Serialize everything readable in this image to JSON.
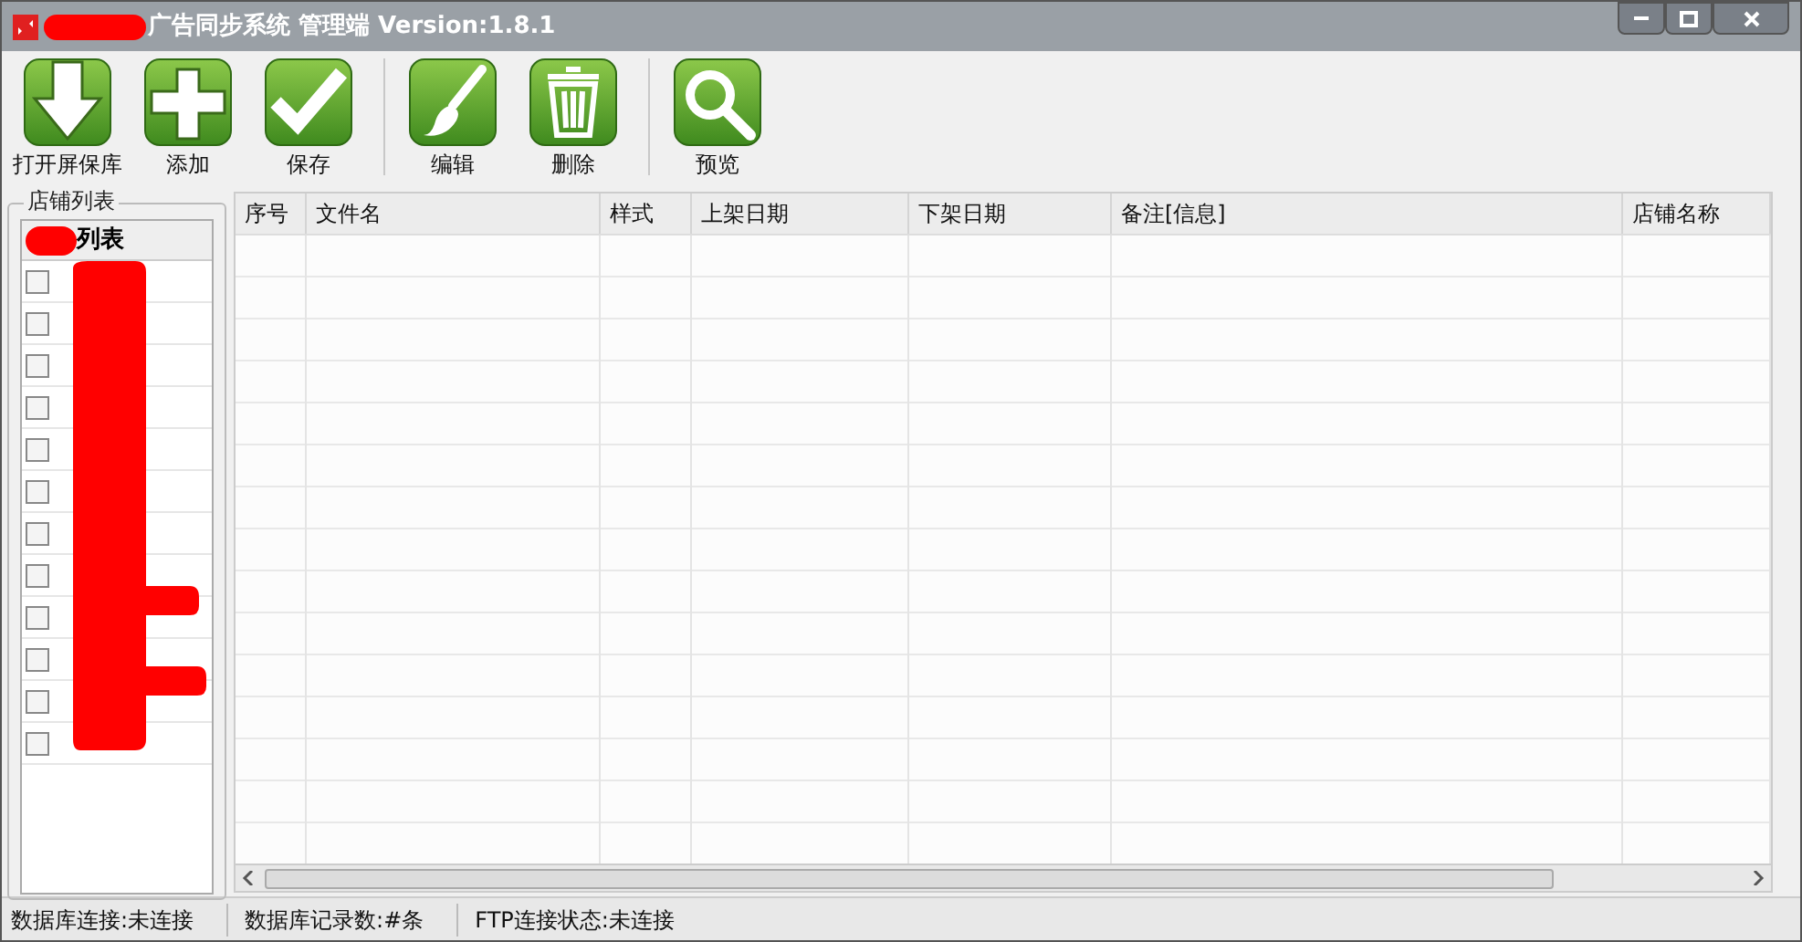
{
  "window": {
    "title": "广告同步系统 管理端 Version:1.8.1"
  },
  "toolbar": [
    {
      "kind": "download",
      "label": "打开屏保库"
    },
    {
      "kind": "add",
      "label": "添加"
    },
    {
      "kind": "check",
      "label": "保存"
    },
    {
      "kind": "brush",
      "label": "编辑"
    },
    {
      "kind": "trash",
      "label": "删除"
    },
    {
      "kind": "search",
      "label": "预览"
    }
  ],
  "shop_panel": {
    "title": "店铺列表",
    "header": "列表",
    "items": [
      {
        "checked": false
      },
      {
        "checked": false
      },
      {
        "checked": false
      },
      {
        "checked": false
      },
      {
        "checked": false
      },
      {
        "checked": false
      },
      {
        "checked": false
      },
      {
        "checked": false
      },
      {
        "checked": false
      },
      {
        "checked": false
      },
      {
        "checked": false
      },
      {
        "checked": false
      }
    ]
  },
  "table": {
    "columns": [
      "序号",
      "文件名",
      "样式",
      "上架日期",
      "下架日期",
      "备注[信息]",
      "店铺名称"
    ]
  },
  "status_bar": [
    "数据库连接:未连接",
    "数据库记录数:#条",
    "FTP连接状态:未连接"
  ]
}
